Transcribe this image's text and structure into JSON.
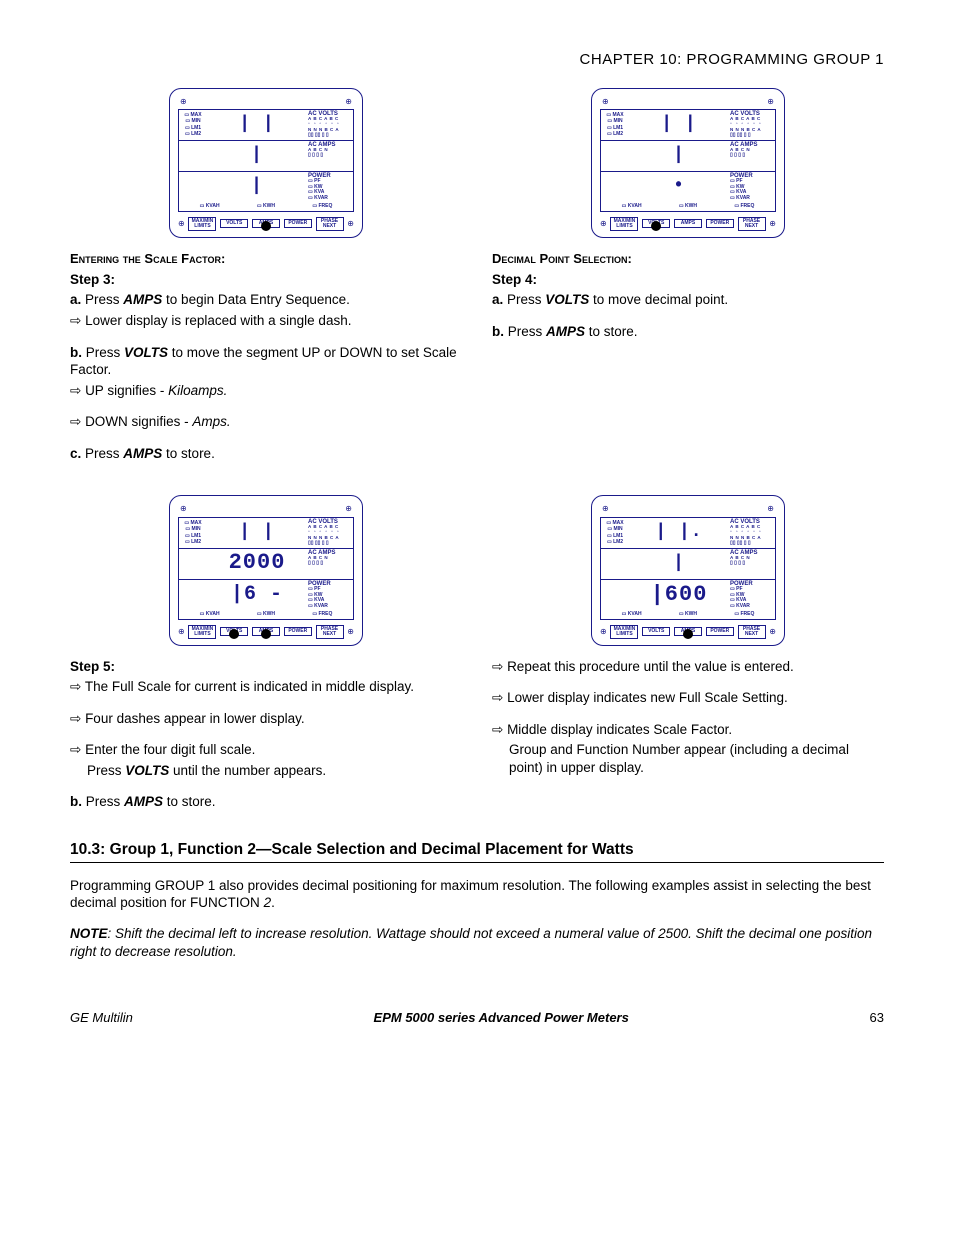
{
  "header": "CHAPTER 10: PROGRAMMING GROUP 1",
  "meter_labels": {
    "left": [
      "MAX",
      "MIN",
      "LM1",
      "LM2"
    ],
    "acvolts": "AC VOLTS",
    "acvolts_sub1": "A B C A B C",
    "acvolts_sub2": "N N N B C A",
    "acamps": "AC AMPS",
    "acamps_sub": "A B C N",
    "power": "POWER",
    "pw": [
      "PF",
      "KW",
      "KVA",
      "KVAR"
    ],
    "bottom": [
      "KVAH",
      "KWH",
      "FREQ"
    ],
    "buttons": {
      "maxmin": "MAX/MIN",
      "limits": "LIMITS",
      "volts": "VOLTS",
      "amps": "AMPS",
      "power": "POWER",
      "phase": "PHASE",
      "next": "NEXT"
    }
  },
  "meters": {
    "m1": {
      "top": "| |",
      "mid": "|",
      "bot": "|",
      "pressed": [
        "amps"
      ]
    },
    "m2": {
      "top": "| |",
      "mid": "|",
      "bot": "•",
      "pressed": [
        "volts"
      ]
    },
    "m3": {
      "top": "| |",
      "mid": "2000",
      "bot": "|6 -",
      "pressed": [
        "volts",
        "amps"
      ]
    },
    "m4": {
      "top": "| |.",
      "mid": "|",
      "bot": "|600",
      "pressed": [
        "amps"
      ]
    }
  },
  "left_top": {
    "title": "Entering the Scale Factor:",
    "step": "Step 3:",
    "a": "Press ",
    "a_bold": "AMPS",
    "a_end": " to begin Data Entry Sequence.",
    "a_arrow": "Lower display is replaced with a single dash.",
    "b": "Press ",
    "b_bold": "VOLTS",
    "b_end": " to move the segment UP or DOWN to set Scale Factor.",
    "b_arrow1_pre": "UP signifies - ",
    "b_arrow1_it": "Kiloamps.",
    "b_arrow2_pre": "DOWN signifies - ",
    "b_arrow2_it": "Amps.",
    "c": "Press ",
    "c_bold": "AMPS",
    "c_end": " to store."
  },
  "right_top": {
    "title": "Decimal Point Selection:",
    "step": "Step 4:",
    "a": "Press ",
    "a_bold": "VOLTS",
    "a_end": " to move decimal point.",
    "b": "Press ",
    "b_bold": "AMPS",
    "b_end": " to store."
  },
  "left_bot": {
    "step": "Step 5:",
    "l1": "The Full Scale for current is indicated in middle display.",
    "l2": "Four dashes appear in lower display.",
    "l3a": "Enter the four digit full scale.",
    "l3b_pre": "Press ",
    "l3b_bold": "VOLTS",
    "l3b_end": " until the number appears.",
    "b": "Press ",
    "b_bold": "AMPS",
    "b_end": " to store."
  },
  "right_bot": {
    "l1": "Repeat this procedure until the value is entered.",
    "l2": "Lower display indicates new Full Scale Setting.",
    "l3": "Middle display indicates Scale Factor.",
    "l3b": "Group and Function Number appear (including a decimal point) in upper display."
  },
  "section": "10.3: Group 1, Function 2—Scale Selection and Decimal Placement for Watts",
  "para1a": "Programming GROUP 1 also provides decimal positioning for maximum resolution. The following examples assist in selecting the best decimal position for FUNCTION ",
  "para1b": "2",
  "para1c": ".",
  "note_label": "NOTE",
  "note_text": ":  Shift the decimal left to increase resolution.  Wattage should not exceed a numeral value of 2500.  Shift the decimal one position right to decrease resolution.",
  "footer": {
    "left": "GE Multilin",
    "mid": "EPM 5000 series Advanced Power Meters",
    "right": "63"
  }
}
